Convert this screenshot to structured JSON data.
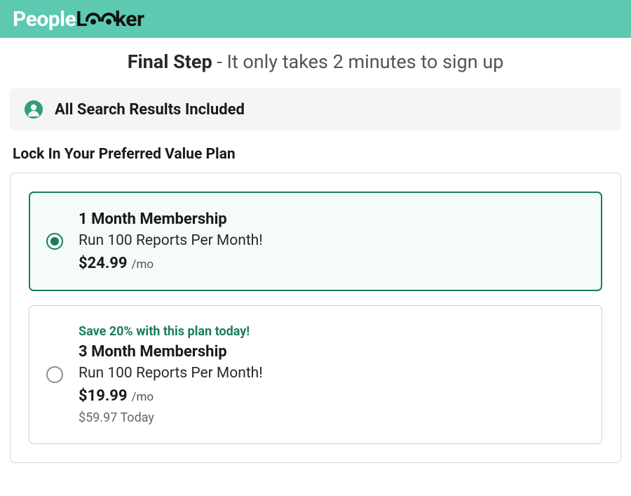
{
  "brand": {
    "part1": "People",
    "part2": "L",
    "part3": "ker"
  },
  "heading": {
    "bold": "Final Step",
    "light": " - It only takes 2 minutes to sign up"
  },
  "banner": {
    "text": "All Search Results Included"
  },
  "subhead": "Lock In Your Preferred Value Plan",
  "plans": [
    {
      "save": "",
      "title": "1 Month Membership",
      "desc": "Run 100 Reports Per Month!",
      "price": "$24.99",
      "suffix": "/mo",
      "today": "",
      "selected": true
    },
    {
      "save": "Save 20% with this plan today!",
      "title": "3 Month Membership",
      "desc": "Run 100 Reports Per Month!",
      "price": "$19.99",
      "suffix": "/mo",
      "today": "$59.97 Today",
      "selected": false
    }
  ],
  "colors": {
    "brand_bg": "#5cc9b0",
    "accent": "#197d5e"
  }
}
